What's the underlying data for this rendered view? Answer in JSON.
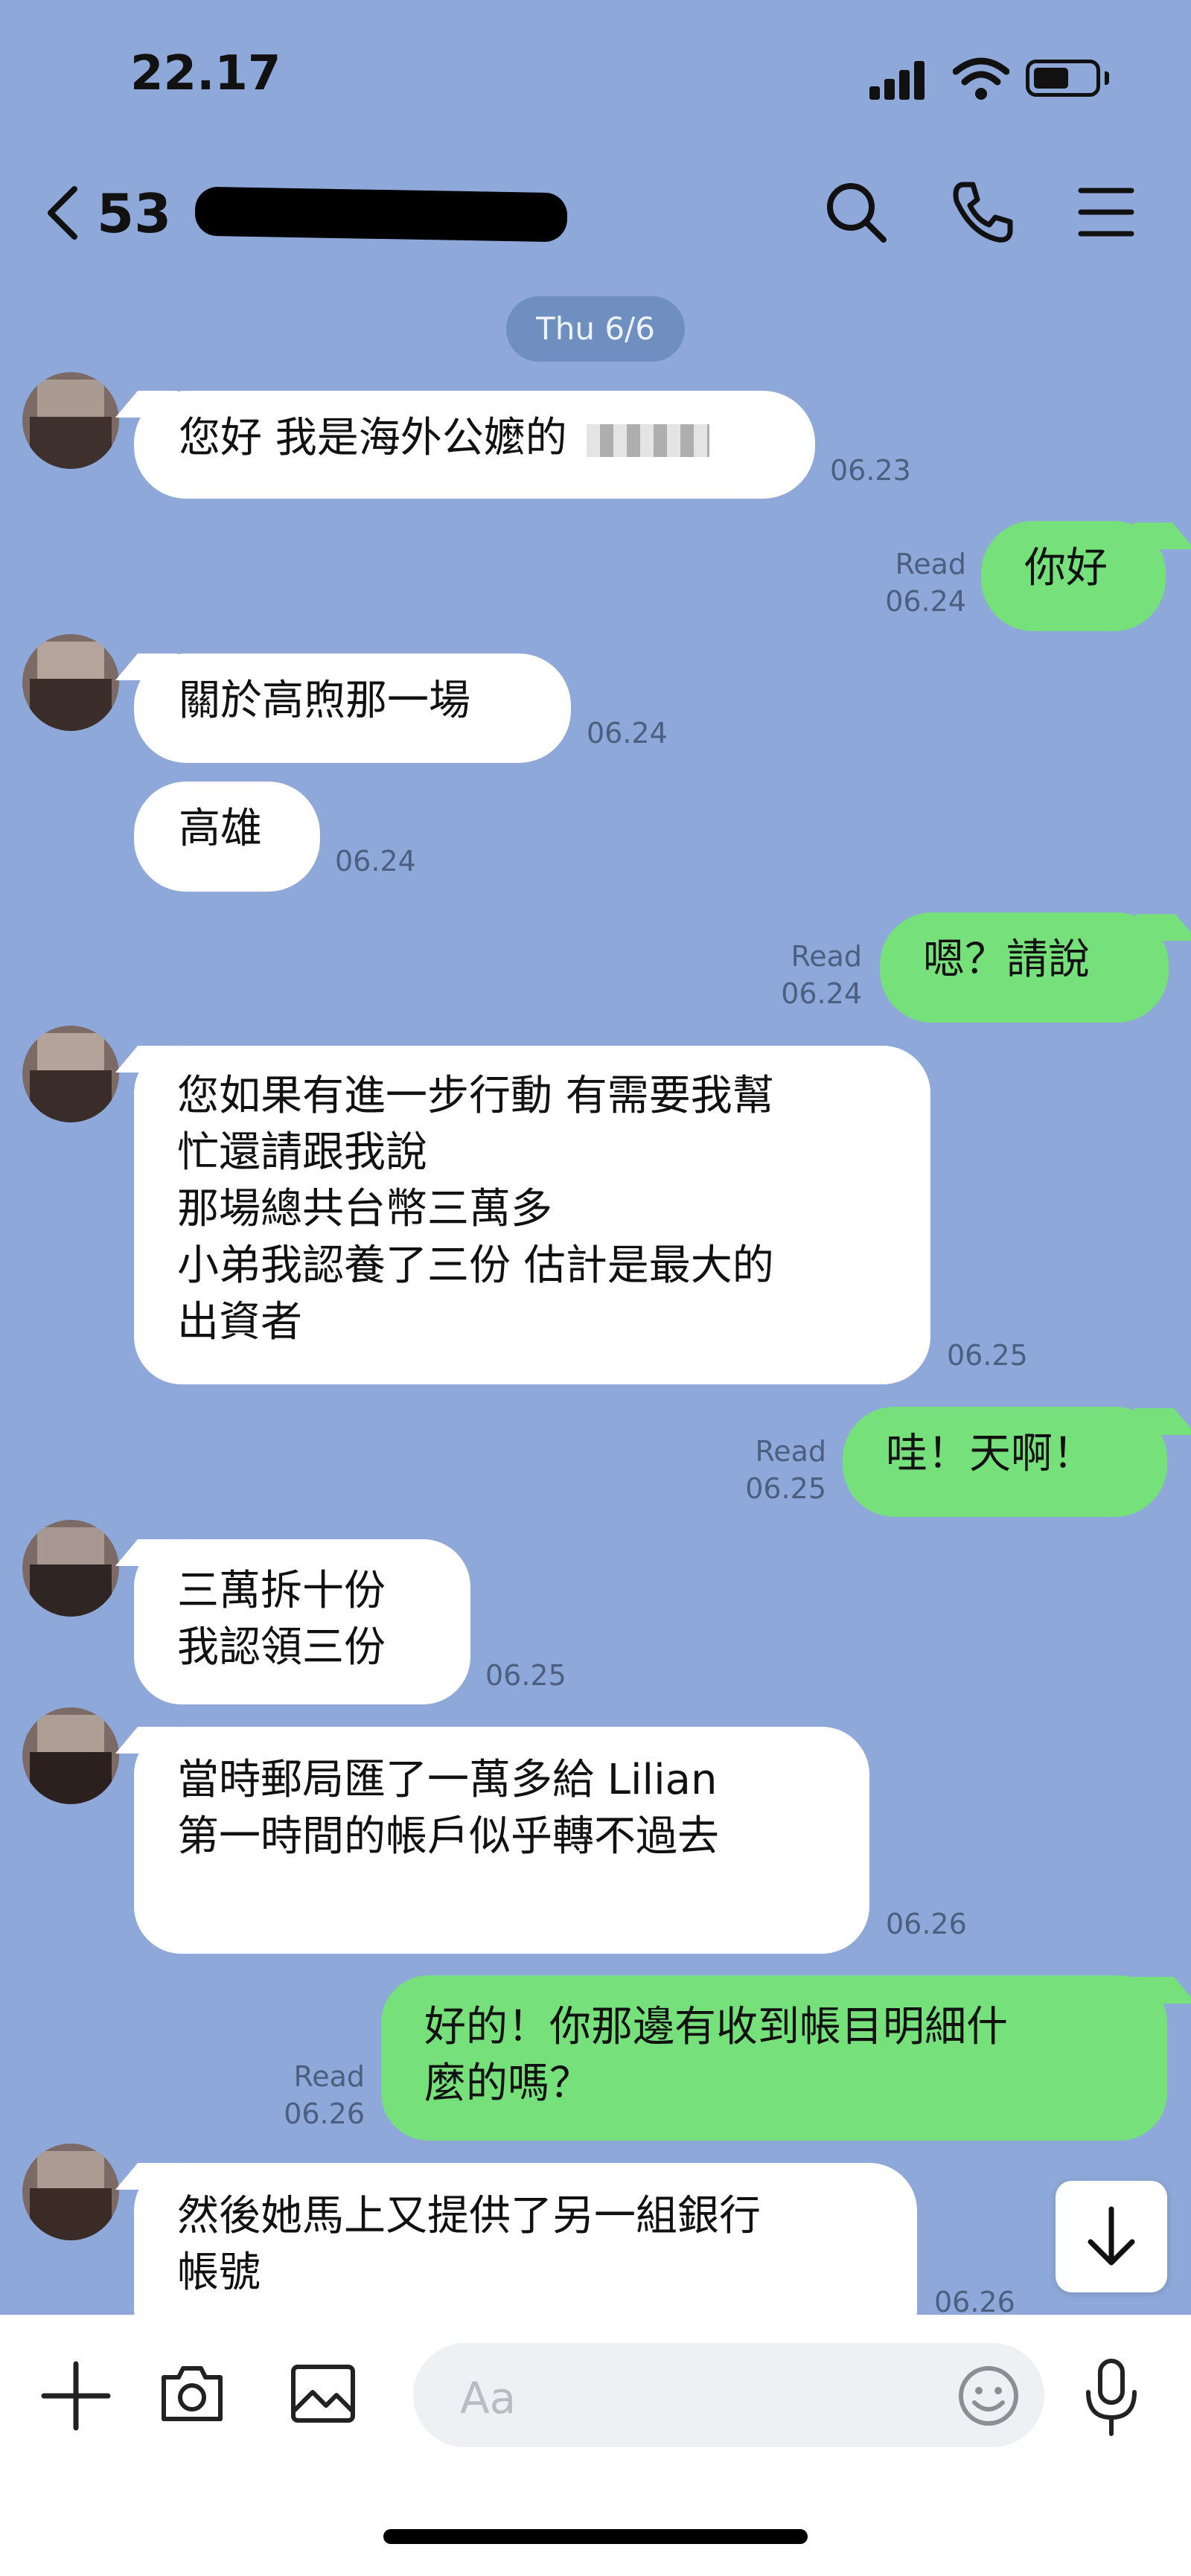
{
  "status": {
    "time": "22.17"
  },
  "header": {
    "back_count": "53"
  },
  "date_chip": "Thu 6/6",
  "messages": [
    {
      "from": "in",
      "text": "您好 我是海外公嬤的",
      "time": "06.23"
    },
    {
      "from": "out",
      "text": "你好",
      "read": "Read",
      "time": "06.24"
    },
    {
      "from": "in",
      "text": "關於高煦那一場",
      "time": "06.24"
    },
    {
      "from": "in",
      "text": "高雄",
      "time": "06.24"
    },
    {
      "from": "out",
      "text": "嗯？請說",
      "read": "Read",
      "time": "06.24"
    },
    {
      "from": "in",
      "lines": [
        "您如果有進一步行動 有需要我幫",
        "忙還請跟我說",
        "那場總共台幣三萬多",
        "小弟我認養了三份 估計是最大的",
        "出資者"
      ],
      "time": "06.25"
    },
    {
      "from": "out",
      "text": "哇！天啊！",
      "read": "Read",
      "time": "06.25"
    },
    {
      "from": "in",
      "lines": [
        "三萬拆十份",
        "我認領三份"
      ],
      "time": "06.25"
    },
    {
      "from": "in",
      "lines": [
        "當時郵局匯了一萬多給 Lilian",
        "第一時間的帳戶似乎轉不過去"
      ],
      "time": "06.26"
    },
    {
      "from": "out",
      "lines": [
        "好的！你那邊有收到帳目明細什",
        "麼的嗎？"
      ],
      "read": "Read",
      "time": "06.26"
    },
    {
      "from": "in",
      "lines": [
        "然後她馬上又提供了另一組銀行",
        "帳號"
      ],
      "time": "06.26"
    }
  ],
  "composer": {
    "placeholder": "Aa"
  },
  "icons": [
    "signal-icon",
    "wifi-icon",
    "battery-icon",
    "back-chevron-icon",
    "search-icon",
    "phone-icon",
    "menu-icon",
    "plus-icon",
    "camera-icon",
    "image-icon",
    "emoji-icon",
    "microphone-icon",
    "scroll-down-icon"
  ],
  "colors": {
    "background": "#8ea9d9",
    "incoming": "#ffffff",
    "outgoing": "#76e07a"
  }
}
